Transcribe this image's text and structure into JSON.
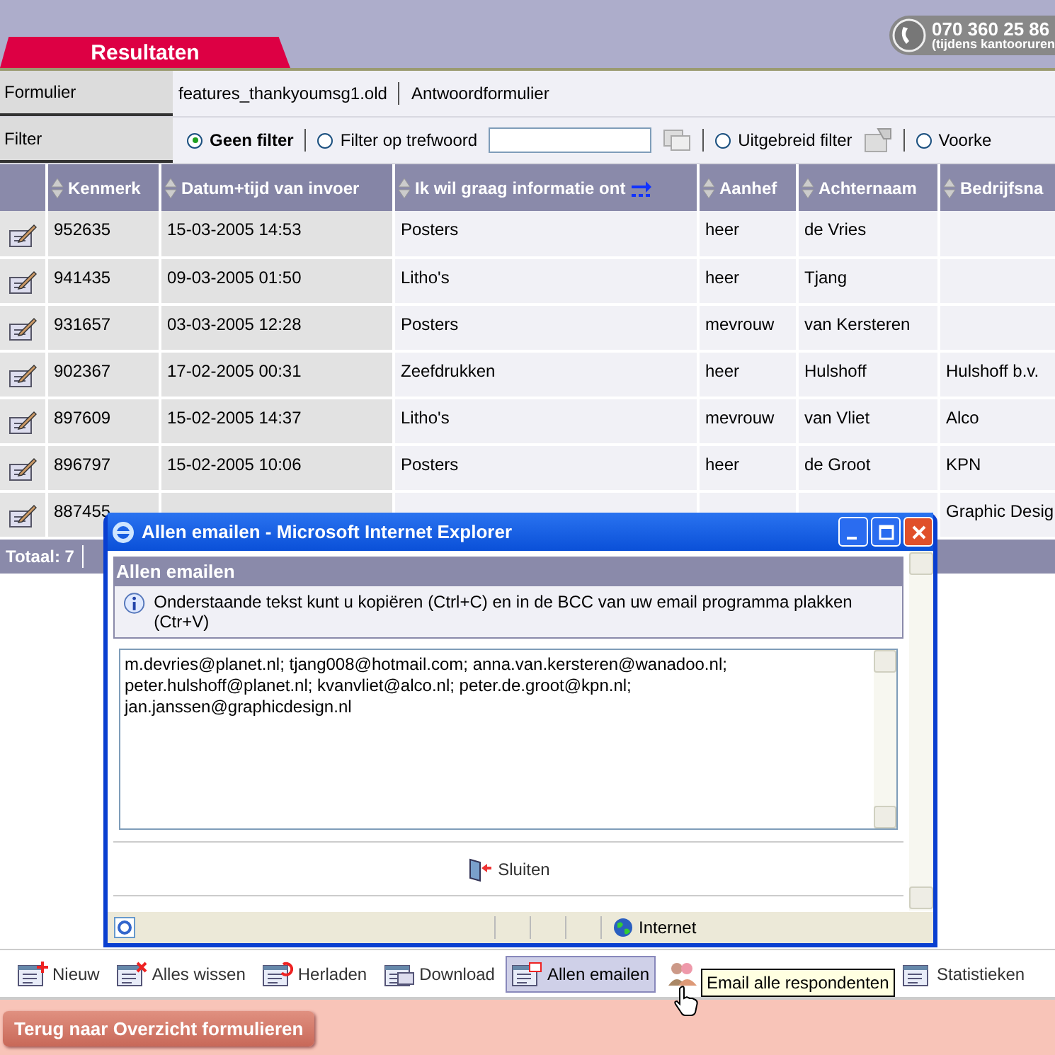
{
  "header": {
    "tab": "Resultaten",
    "phone": "070 360 25 86",
    "phone_note": "(tijdens kantooruren"
  },
  "form_info": {
    "label": "Formulier",
    "name": "features_thankyoumsg1.old",
    "type": "Antwoordformulier"
  },
  "filter": {
    "label": "Filter",
    "options": [
      {
        "label": "Geen filter",
        "selected": true,
        "kind": "plain"
      },
      {
        "label": "Filter op trefwoord",
        "selected": false,
        "kind": "keyword"
      },
      {
        "label": "Uitgebreid filter",
        "selected": false,
        "kind": "advanced"
      },
      {
        "label": "Voorke",
        "selected": false,
        "kind": "plain"
      }
    ]
  },
  "table": {
    "columns": [
      {
        "label": "Kenmerk",
        "shaded": true,
        "more": false
      },
      {
        "label": "Datum+tijd van invoer",
        "shaded": true,
        "more": false
      },
      {
        "label": "Ik wil graag informatie ont",
        "shaded": false,
        "more": true
      },
      {
        "label": "Aanhef",
        "shaded": false,
        "more": false
      },
      {
        "label": "Achternaam",
        "shaded": false,
        "more": false
      },
      {
        "label": "Bedrijfsna",
        "shaded": false,
        "more": false
      }
    ],
    "rows": [
      [
        "952635",
        "15-03-2005 14:53",
        "Posters",
        "heer",
        "de Vries",
        ""
      ],
      [
        "941435",
        "09-03-2005 01:50",
        "Litho's",
        "heer",
        "Tjang",
        ""
      ],
      [
        "931657",
        "03-03-2005 12:28",
        "Posters",
        "mevrouw",
        "van Kersteren",
        ""
      ],
      [
        "902367",
        "17-02-2005 00:31",
        "Zeefdrukken",
        "heer",
        "Hulshoff",
        "Hulshoff b.v."
      ],
      [
        "897609",
        "15-02-2005 14:37",
        "Litho's",
        "mevrouw",
        "van Vliet",
        "Alco"
      ],
      [
        "896797",
        "15-02-2005 10:06",
        "Posters",
        "heer",
        "de Groot",
        "KPN"
      ],
      [
        "887455",
        "",
        "",
        "",
        "",
        "Graphic Desig"
      ]
    ]
  },
  "total": "Totaal: 7",
  "toolbar": [
    {
      "label": "Nieuw",
      "selected": false,
      "kind": "new"
    },
    {
      "label": "Alles wissen",
      "selected": false,
      "kind": "clear"
    },
    {
      "label": "Herladen",
      "selected": false,
      "kind": "reload"
    },
    {
      "label": "Download",
      "selected": false,
      "kind": "download"
    },
    {
      "label": "Allen emailen",
      "selected": true,
      "kind": "email"
    },
    {
      "selected": false,
      "kind": "people"
    },
    {
      "label": "Statistieken",
      "selected": false,
      "kind": "stats"
    }
  ],
  "tooltip": "Email alle respondenten",
  "back_button": "Terug naar Overzicht formulieren",
  "dialog": {
    "title": "Allen emailen - Microsoft Internet Explorer",
    "heading": "Allen emailen",
    "info": "Onderstaande tekst kunt u kopiëren (Ctrl+C) en in de BCC van uw email programma plakken (Ctr+V)",
    "emails": "m.devries@planet.nl; tjang008@hotmail.com; anna.van.kersteren@wanadoo.nl;\npeter.hulshoff@planet.nl; kvanvliet@alco.nl; peter.de.groot@kpn.nl;\njan.janssen@graphicdesign.nl",
    "close_button": "Sluiten",
    "zone": "Internet"
  }
}
